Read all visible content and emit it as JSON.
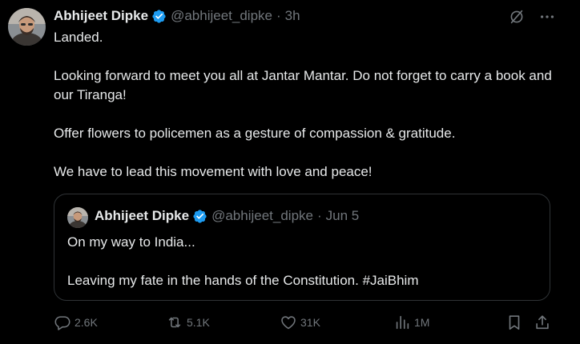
{
  "author": {
    "name": "Abhijeet Dipke",
    "handle": "@abhijeet_dipke",
    "separator": "·",
    "time": "3h"
  },
  "post": {
    "paragraphs": [
      "Landed.",
      "Looking forward to meet you all at Jantar Mantar. Do not forget to carry a book and our Tiranga!",
      "Offer flowers to policemen as a gesture of compassion & gratitude.",
      "We have to lead this movement with love and peace!"
    ]
  },
  "quote": {
    "name": "Abhijeet Dipke",
    "handle": "@abhijeet_dipke",
    "separator": "·",
    "date": "Jun 5",
    "paragraphs": [
      "On my way to India...",
      "Leaving my fate in the hands of the Constitution. #JaiBhim"
    ]
  },
  "actions": {
    "replies": "2.6K",
    "reposts": "5.1K",
    "likes": "31K",
    "views": "1M"
  },
  "icons": {
    "verified": "verified-badge-icon",
    "grok": "grok-icon",
    "more": "more-options-icon",
    "reply": "reply-icon",
    "repost": "repost-icon",
    "like": "heart-icon",
    "views": "views-chart-icon",
    "bookmark": "bookmark-icon",
    "share": "share-icon"
  },
  "colors": {
    "background": "#000000",
    "text": "#e7e9ea",
    "secondary": "#71767b",
    "verified": "#1d9bf0",
    "border": "#2f3336"
  }
}
